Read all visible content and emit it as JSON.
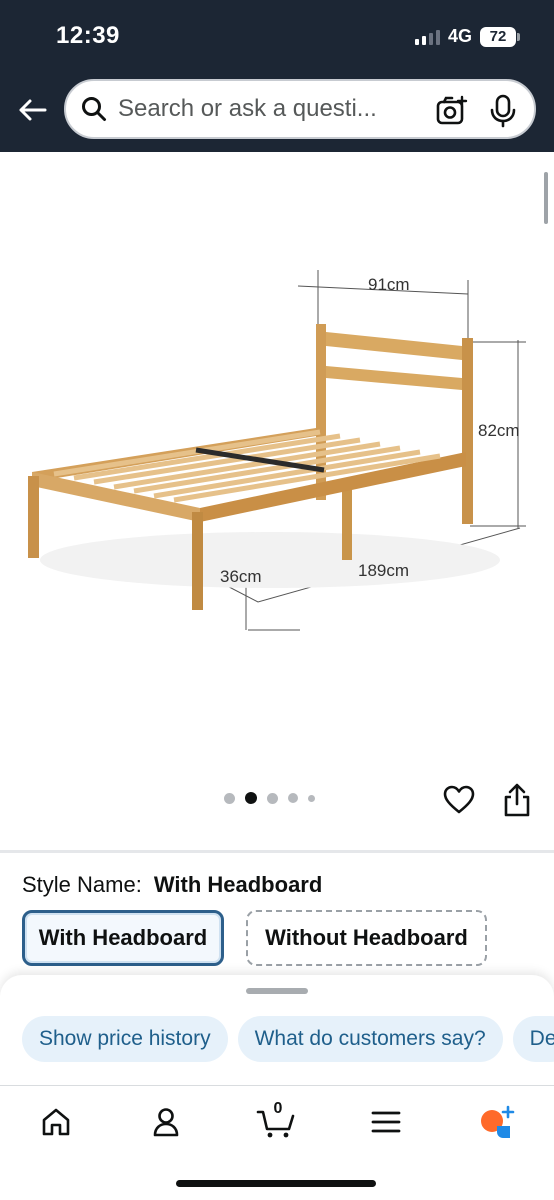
{
  "status_bar": {
    "time": "12:39",
    "network": "4G",
    "battery": "72"
  },
  "search": {
    "placeholder": "Search or ask a questi..."
  },
  "product_image": {
    "dimensions": {
      "width": "91cm",
      "height": "82cm",
      "leg_height": "36cm",
      "length": "189cm"
    },
    "carousel": {
      "total": 5,
      "active_index": 1
    }
  },
  "style": {
    "label": "Style Name:",
    "selected": "With Headboard",
    "options": [
      "With Headboard",
      "Without Headboard"
    ]
  },
  "chips": [
    "Show price history",
    "What do customers say?",
    "De"
  ],
  "bottom_nav": {
    "cart_count": "0"
  },
  "colors": {
    "header_bg": "#1c2634",
    "chip_bg": "#e6f1fa",
    "chip_text": "#1f5f8b",
    "selected_border": "#2d5f8b",
    "rufus_orange": "#ff6a2a",
    "rufus_blue": "#1f8ae6"
  },
  "icons": [
    "back-arrow-icon",
    "search-icon",
    "camera-icon",
    "microphone-icon",
    "heart-icon",
    "share-icon",
    "home-icon",
    "profile-icon",
    "cart-icon",
    "menu-icon",
    "rufus-icon"
  ]
}
